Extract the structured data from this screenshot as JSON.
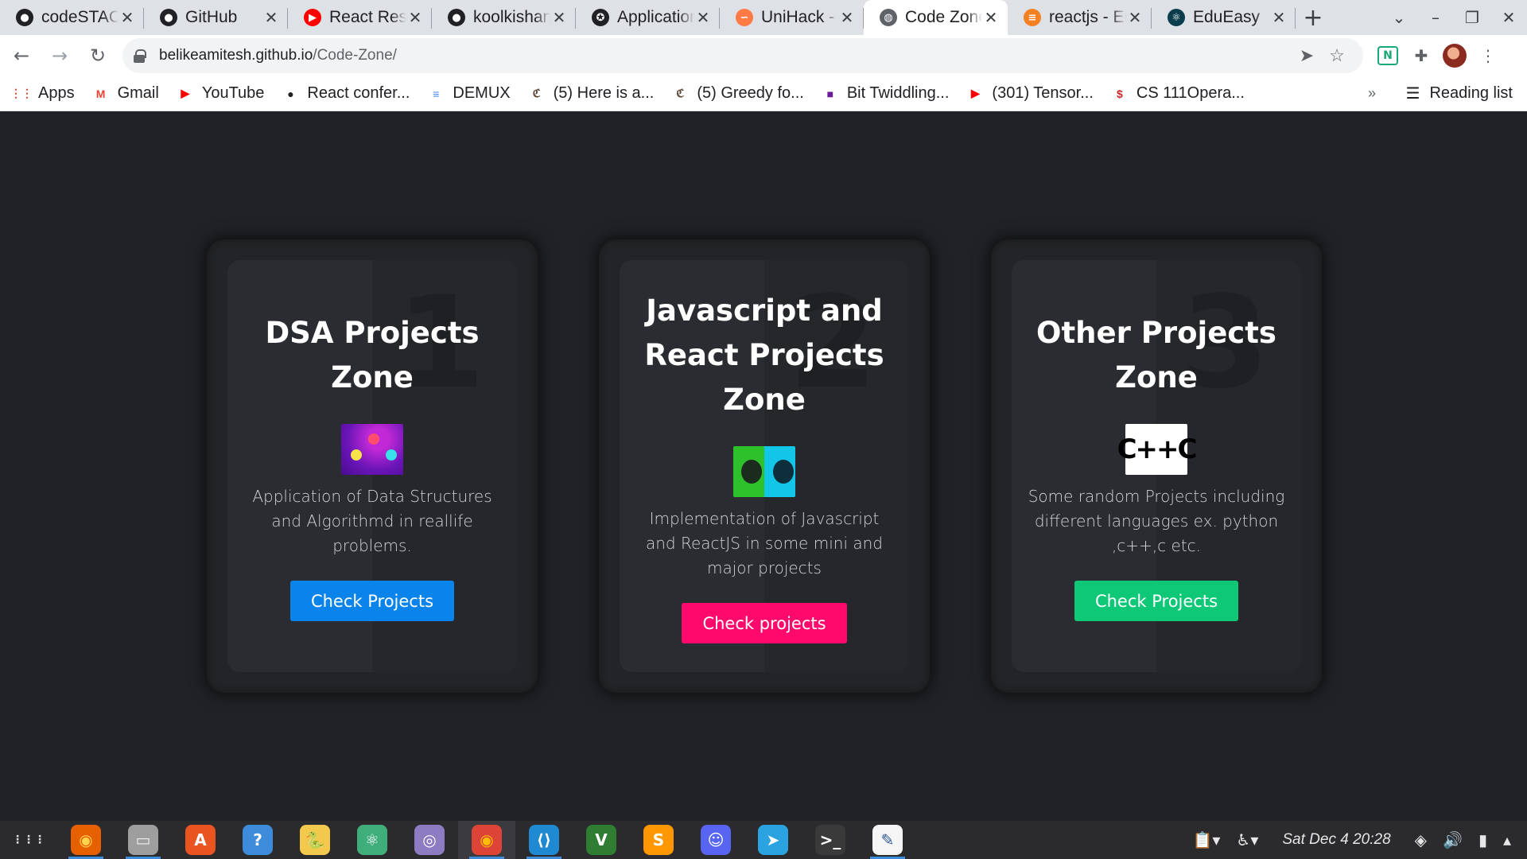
{
  "browser": {
    "tabs": [
      {
        "title": "codeSTACK",
        "favicon": "github-icon",
        "color": "#202124",
        "active": false
      },
      {
        "title": "GitHub",
        "favicon": "github-icon",
        "color": "#202124",
        "active": false
      },
      {
        "title": "React Resume",
        "favicon": "youtube-icon",
        "color": "#ff0000",
        "active": false
      },
      {
        "title": "koolkishan",
        "favicon": "github-icon",
        "color": "#202124",
        "active": false
      },
      {
        "title": "Application",
        "favicon": "badge-icon",
        "color": "#202124",
        "active": false
      },
      {
        "title": "UniHack - Devfolio",
        "favicon": "unihack-icon",
        "color": "#ff7a45",
        "active": false
      },
      {
        "title": "Code Zone",
        "favicon": "globe-icon",
        "color": "#5f6368",
        "active": true
      },
      {
        "title": "reactjs - Error",
        "favicon": "stackoverflow-icon",
        "color": "#f48024",
        "active": false
      },
      {
        "title": "EduEasy",
        "favicon": "react-icon",
        "color": "#0b3d4c",
        "active": false
      }
    ],
    "new_tab": "+",
    "url": {
      "host": "belikeamitesh.github.io",
      "path": "/Code-Zone/"
    },
    "bookmarks": [
      {
        "label": "Apps",
        "icon": "apps-grid-icon"
      },
      {
        "label": "Gmail",
        "icon": "gmail-icon"
      },
      {
        "label": "YouTube",
        "icon": "youtube-icon"
      },
      {
        "label": "React confer...",
        "icon": "github-icon"
      },
      {
        "label": "DEMUX",
        "icon": "docs-icon"
      },
      {
        "label": "(5) Here is a...",
        "icon": "codechef-icon"
      },
      {
        "label": "(5) Greedy fo...",
        "icon": "codechef-icon"
      },
      {
        "label": "Bit Twiddling...",
        "icon": "site-icon"
      },
      {
        "label": "(301) Tensor...",
        "icon": "youtube-icon"
      },
      {
        "label": "CS 111Opera...",
        "icon": "dollar-icon"
      }
    ],
    "bookmarks_more": "»",
    "reading_list": "Reading list"
  },
  "page": {
    "cards": [
      {
        "number": "1",
        "title": "DSA Projects Zone",
        "description": "Application of Data Structures and Algorithmd in reallife problems.",
        "button_label": "Check Projects",
        "button_color": "#0a84ea",
        "thumb": "dsa-thumbnail"
      },
      {
        "number": "2",
        "title": "Javascript and React Projects Zone",
        "description": "Implementation of Javascript and ReactJS in some mini and major projects",
        "button_label": "Check projects",
        "button_color": "#ff0a6c",
        "thumb": "js-react-thumbnail"
      },
      {
        "number": "3",
        "title": "Other Projects Zone",
        "description": "Some random Projects including different languages ex. python ,c++,c etc.",
        "button_label": "Check Projects",
        "button_color": "#0ec878",
        "thumb": "c-cpp-thumbnail",
        "thumb_text": "C++C"
      }
    ]
  },
  "taskbar": {
    "apps": [
      "app-grid-icon",
      "firefox-icon",
      "files-icon",
      "software-icon",
      "help-icon",
      "python-icon",
      "atom-icon",
      "screenshot-icon",
      "chrome-icon",
      "vscode-icon",
      "vim-icon",
      "sublime-icon",
      "discord-icon",
      "telegram-icon",
      "terminal-icon",
      "text-editor-icon"
    ],
    "clock": "Sat Dec 4  20:28"
  }
}
